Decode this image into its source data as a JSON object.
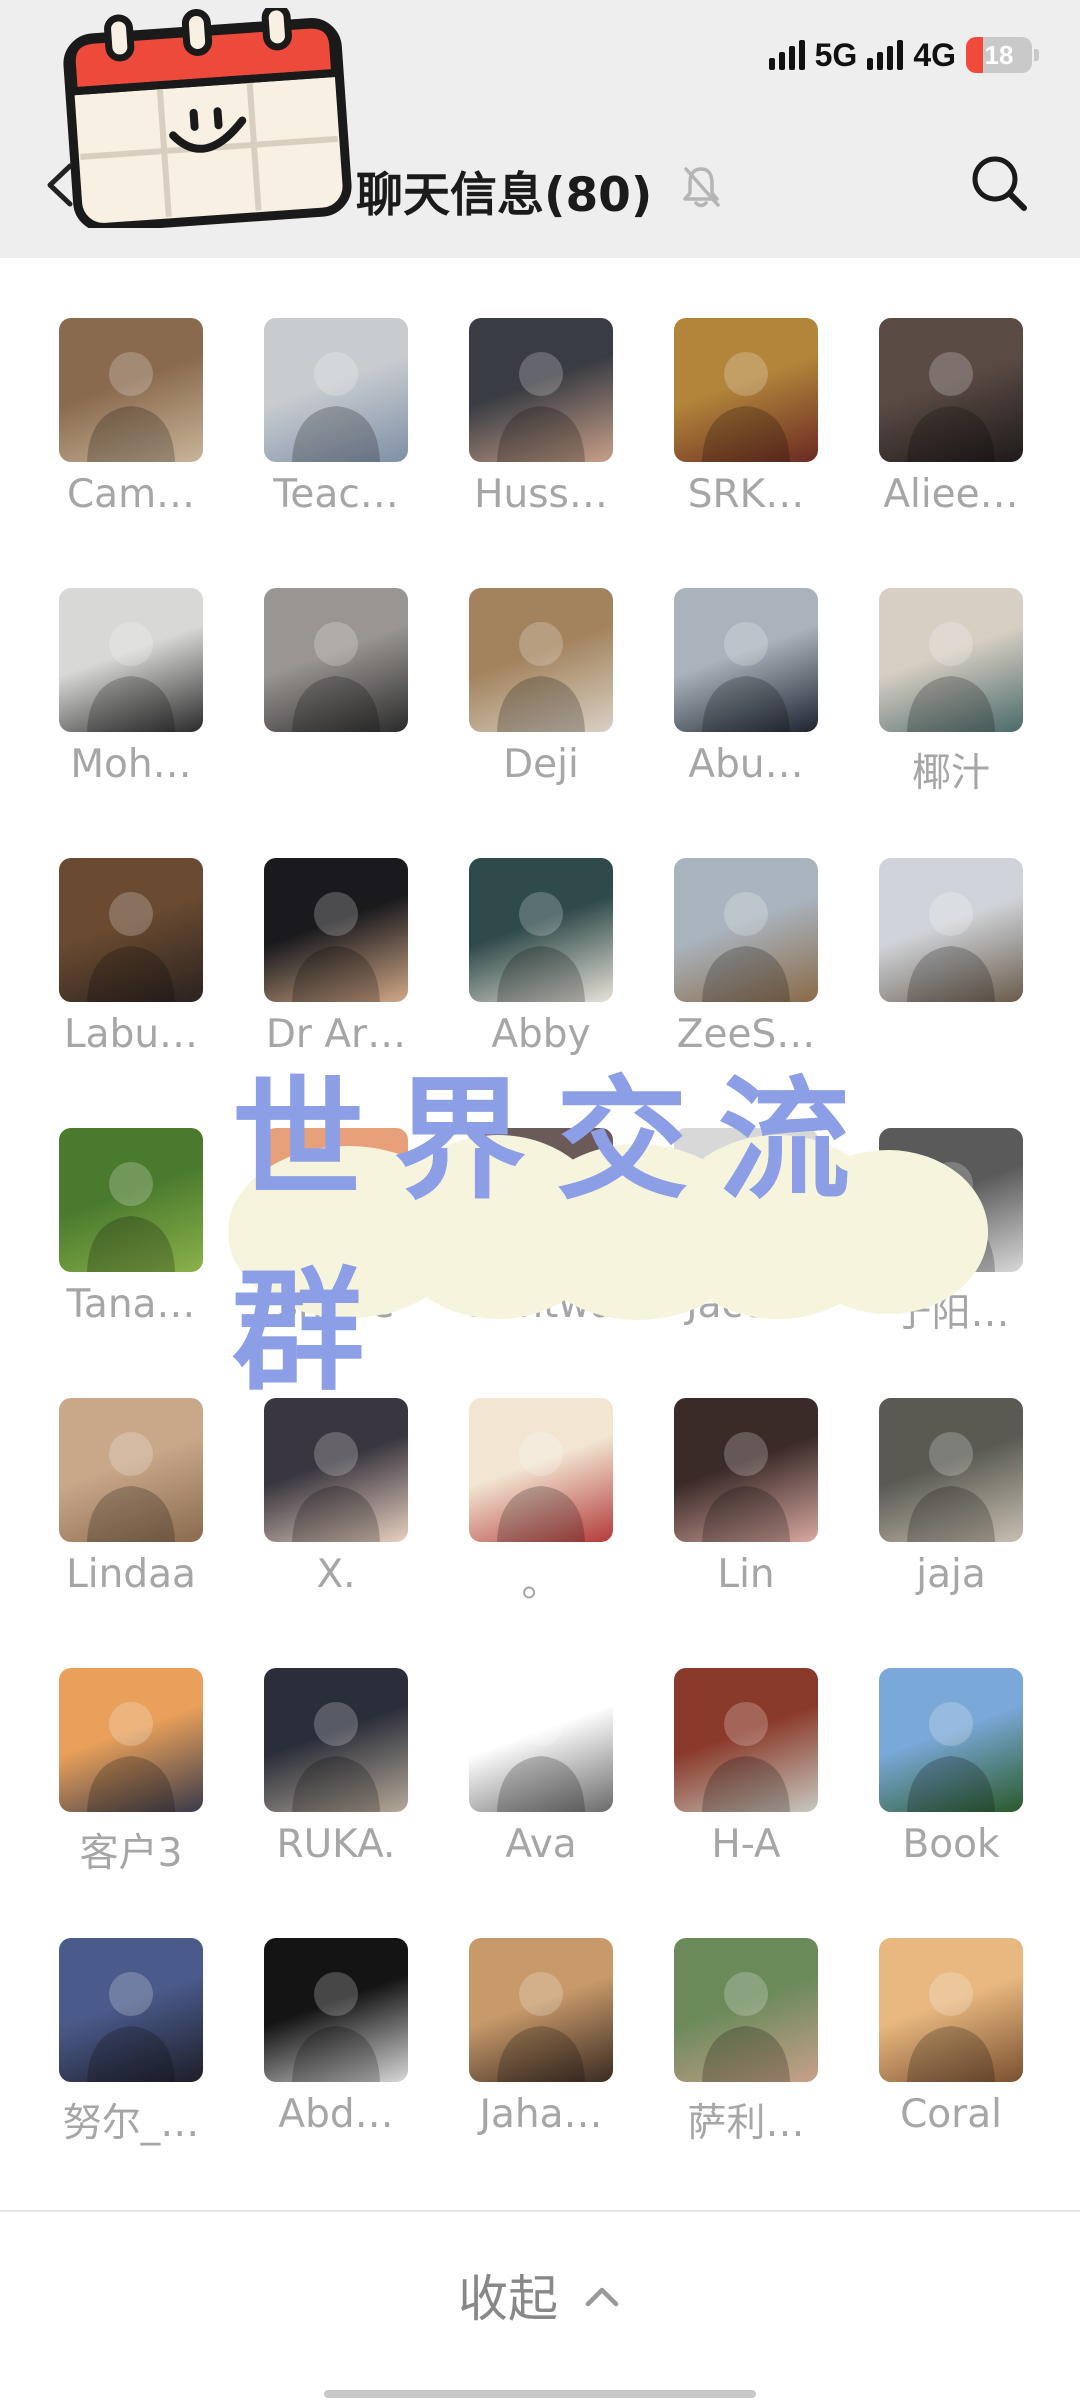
{
  "status_bar": {
    "network1": "5G",
    "network2": "4G",
    "battery": "18"
  },
  "header": {
    "title": "聊天信息(80)"
  },
  "members": [
    {
      "name": "Cam…",
      "colors": [
        "#8a6a4e",
        "#c9b59a"
      ]
    },
    {
      "name": "Teac…",
      "colors": [
        "#c8ccd0",
        "#7f8fa6"
      ]
    },
    {
      "name": "Huss…",
      "colors": [
        "#3a3c44",
        "#c8a088"
      ]
    },
    {
      "name": "SRK…",
      "colors": [
        "#b2853a",
        "#6a2a22"
      ]
    },
    {
      "name": "Aliee…",
      "colors": [
        "#5a4a44",
        "#1e1a1a"
      ]
    },
    {
      "name": "Moh…",
      "colors": [
        "#d8d8d6",
        "#2a2a2a"
      ]
    },
    {
      "name": "",
      "colors": [
        "#9a9592",
        "#2b2b2b"
      ]
    },
    {
      "name": "Deji",
      "colors": [
        "#a3835d",
        "#d8d0c4"
      ]
    },
    {
      "name": "Abu…",
      "colors": [
        "#aab3bb",
        "#1d2430"
      ]
    },
    {
      "name": "椰汁",
      "colors": [
        "#d8cfc4",
        "#4a6a6a"
      ]
    },
    {
      "name": "Labu…",
      "colors": [
        "#6a4a30",
        "#2a2220"
      ]
    },
    {
      "name": "Dr Ar…",
      "colors": [
        "#1a1a1e",
        "#d2a887"
      ]
    },
    {
      "name": "Abby",
      "colors": [
        "#2e4a4a",
        "#e8e2d8"
      ]
    },
    {
      "name": "ZeeS…",
      "colors": [
        "#a9b4be",
        "#8a6a48"
      ]
    },
    {
      "name": "",
      "colors": [
        "#d0d4da",
        "#6a5a4a"
      ]
    },
    {
      "name": "Tana…",
      "colors": [
        "#4a7a2e",
        "#8ab24a"
      ]
    },
    {
      "name": "shyne",
      "colors": [
        "#e8a07a",
        "#c86a4a"
      ]
    },
    {
      "name": "Bantwa",
      "colors": [
        "#6a5a58",
        "#3a3230"
      ]
    },
    {
      "name": "Jaco…",
      "colors": [
        "#d8d8d8",
        "#9aa2aa"
      ]
    },
    {
      "name": "于阳…",
      "colors": [
        "#5a5a5a",
        "#d8d8d8"
      ]
    },
    {
      "name": "Lindaa",
      "colors": [
        "#c9a88a",
        "#8a6a4e"
      ]
    },
    {
      "name": "X.",
      "colors": [
        "#3a3640",
        "#e8d0c0"
      ]
    },
    {
      "name": "。",
      "colors": [
        "#f2e6d2",
        "#b33a3a"
      ]
    },
    {
      "name": "Lin",
      "colors": [
        "#3a2a28",
        "#d8a8a0"
      ]
    },
    {
      "name": "jaja",
      "colors": [
        "#5a5a52",
        "#c8bfb2"
      ]
    },
    {
      "name": "客户3",
      "colors": [
        "#e8a05a",
        "#3a3a4a"
      ]
    },
    {
      "name": "RUKA.",
      "colors": [
        "#2a2e3a",
        "#b6a898"
      ]
    },
    {
      "name": "Ava",
      "colors": [
        "#ffffff",
        "#6a6a6a"
      ]
    },
    {
      "name": "H-A",
      "colors": [
        "#8a3a2a",
        "#c8c8c0"
      ]
    },
    {
      "name": "Book",
      "colors": [
        "#7aa8d8",
        "#2a5a2a"
      ]
    },
    {
      "name": "努尔_…",
      "colors": [
        "#4a5a8a",
        "#1e1e28"
      ]
    },
    {
      "name": "Abd…",
      "colors": [
        "#141414",
        "#d8d8d8"
      ]
    },
    {
      "name": "Jaha…",
      "colors": [
        "#c89a6a",
        "#3a2a22"
      ]
    },
    {
      "name": "萨利…",
      "colors": [
        "#6a8a5a",
        "#c8a08a"
      ]
    },
    {
      "name": "Coral",
      "colors": [
        "#e8b880",
        "#7a5030"
      ]
    }
  ],
  "banner": {
    "text": "世界交流群"
  },
  "footer": {
    "collapse_label": "收起"
  }
}
